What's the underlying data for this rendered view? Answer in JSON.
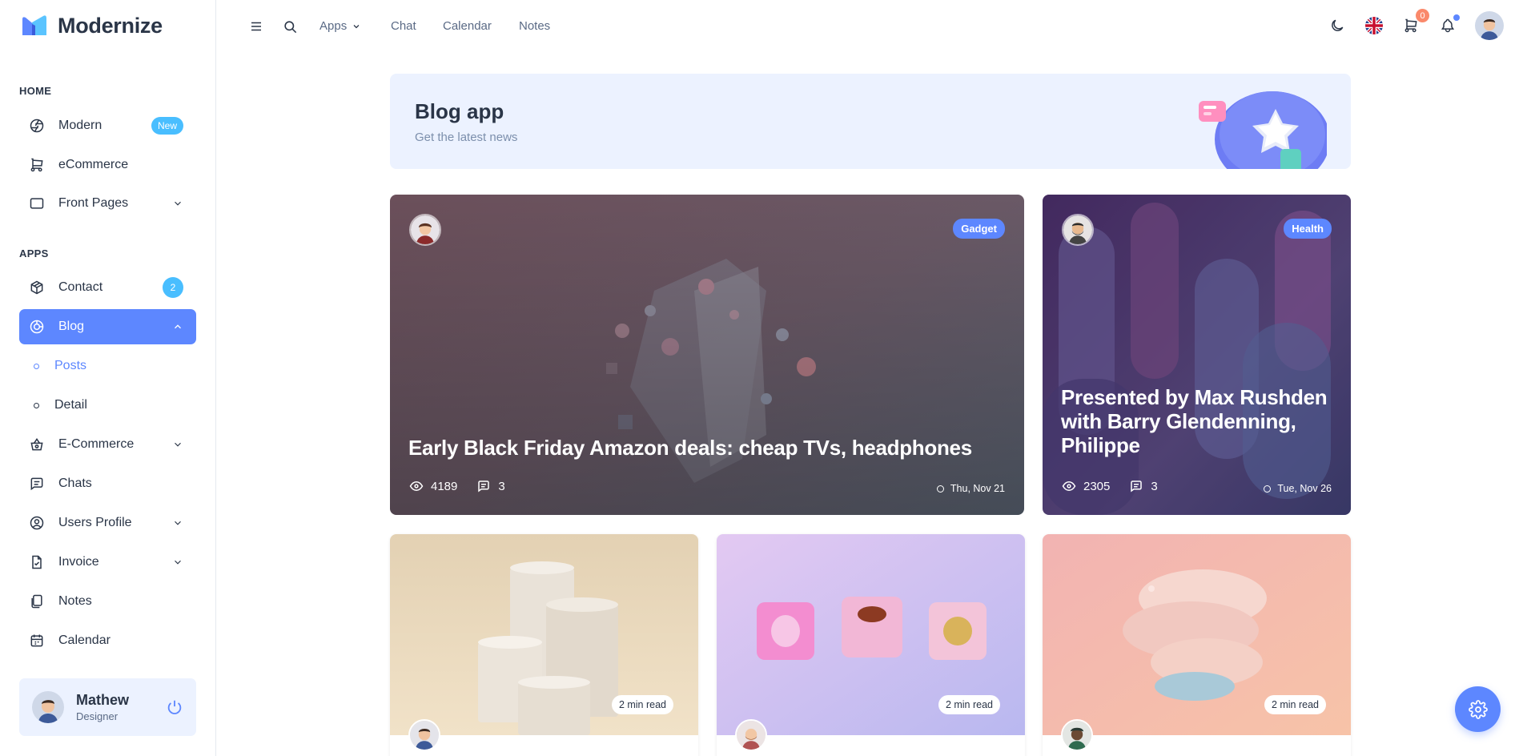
{
  "brand": {
    "name": "Modernize",
    "icon": "modernize-logo"
  },
  "sidebar": {
    "sections": [
      {
        "label": "HOME"
      },
      {
        "label": "APPS"
      }
    ],
    "items": [
      {
        "label": "Modern",
        "icon": "aperture-icon",
        "badge": "New"
      },
      {
        "label": "eCommerce",
        "icon": "shopping-cart-icon"
      },
      {
        "label": "Front Pages",
        "icon": "layout-icon"
      },
      {
        "label": "Contact",
        "icon": "package-icon",
        "badge": "2"
      },
      {
        "label": "Blog",
        "icon": "chart-donut-icon"
      },
      {
        "label": "Posts"
      },
      {
        "label": "Detail"
      },
      {
        "label": "E-Commerce",
        "icon": "basket-icon"
      },
      {
        "label": "Chats",
        "icon": "message-icon"
      },
      {
        "label": "Users Profile",
        "icon": "user-circle-icon"
      },
      {
        "label": "Invoice",
        "icon": "file-check-icon"
      },
      {
        "label": "Notes",
        "icon": "notes-icon"
      },
      {
        "label": "Calendar",
        "icon": "calendar-icon"
      }
    ],
    "profile": {
      "name": "Mathew",
      "role": "Designer"
    }
  },
  "header": {
    "links": [
      {
        "label": "Apps"
      },
      {
        "label": "Chat"
      },
      {
        "label": "Calendar"
      },
      {
        "label": "Notes"
      }
    ],
    "cart_count": "0"
  },
  "banner": {
    "title": "Blog app",
    "subtitle": "Get the latest news"
  },
  "featured": [
    {
      "title": "Early Black Friday Amazon deals: cheap TVs, headphones",
      "category": "Gadget",
      "views": "4189",
      "comments": "3",
      "date": "Thu, Nov 21"
    },
    {
      "title": "Presented by Max Rushden with Barry Glendenning, Philippe",
      "category": "Health",
      "views": "2305",
      "comments": "3",
      "date": "Tue, Nov 26"
    }
  ],
  "posts": [
    {
      "read_time": "2 min read"
    },
    {
      "read_time": "2 min read"
    },
    {
      "read_time": "2 min read"
    }
  ],
  "colors": {
    "primary": "#5d87ff",
    "secondary": "#49beff",
    "primary_light": "#ecf2ff",
    "warning": "#fa896b"
  }
}
